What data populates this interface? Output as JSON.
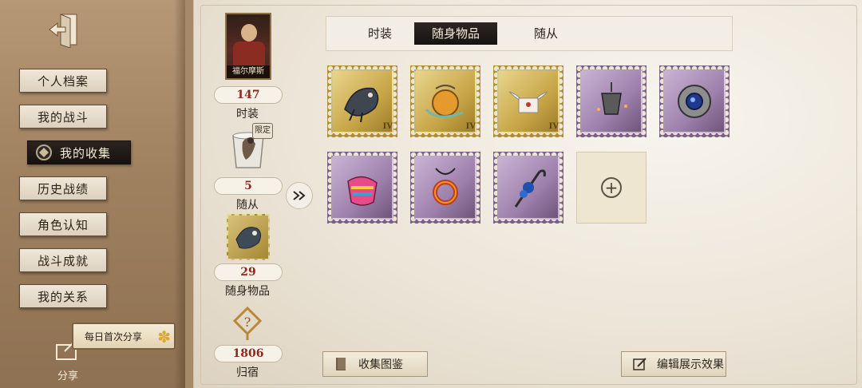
{
  "sidebar": {
    "menu": [
      {
        "label": "个人档案",
        "active": false
      },
      {
        "label": "我的战斗",
        "active": false
      },
      {
        "label": "我的收集",
        "active": true
      },
      {
        "label": "历史战绩",
        "active": false
      },
      {
        "label": "角色认知",
        "active": false
      },
      {
        "label": "战斗成就",
        "active": false
      },
      {
        "label": "我的关系",
        "active": false
      }
    ],
    "share_banner": "每日首次分享",
    "share_label": "分享",
    "exit_icon": "exit-door-icon"
  },
  "stats": {
    "character_name": "福尔摩斯",
    "costume": {
      "count": "147",
      "label": "时装"
    },
    "pet": {
      "count": "5",
      "label": "随从",
      "limited_tag": "限定"
    },
    "accessory": {
      "count": "29",
      "label": "随身物品"
    },
    "home": {
      "count": "1806",
      "label": "归宿"
    }
  },
  "tabs": [
    {
      "label": "时装",
      "active": false
    },
    {
      "label": "随身物品",
      "active": true
    },
    {
      "label": "随从",
      "active": false
    }
  ],
  "items": [
    {
      "name": "mechanical-dragon",
      "rarity": "gold",
      "grade": "IV"
    },
    {
      "name": "orange-pendant",
      "rarity": "gold",
      "grade": "IV"
    },
    {
      "name": "winged-letter",
      "rarity": "gold",
      "grade": "IV"
    },
    {
      "name": "lantern-pendant",
      "rarity": "purple",
      "grade": ""
    },
    {
      "name": "sapphire-gear-ring",
      "rarity": "purple",
      "grade": ""
    },
    {
      "name": "colorful-pouch",
      "rarity": "purple",
      "grade": ""
    },
    {
      "name": "red-ring-necklace",
      "rarity": "purple",
      "grade": ""
    },
    {
      "name": "blue-flower-cane",
      "rarity": "purple",
      "grade": ""
    }
  ],
  "buttons": {
    "collection": "收集图鉴",
    "edit_display": "编辑展示效果"
  },
  "colors": {
    "gold_stamp": "#b08d32",
    "purple_stamp": "#7b5f86",
    "count_text": "#8a2b22",
    "active_tab": "#1d1814"
  }
}
